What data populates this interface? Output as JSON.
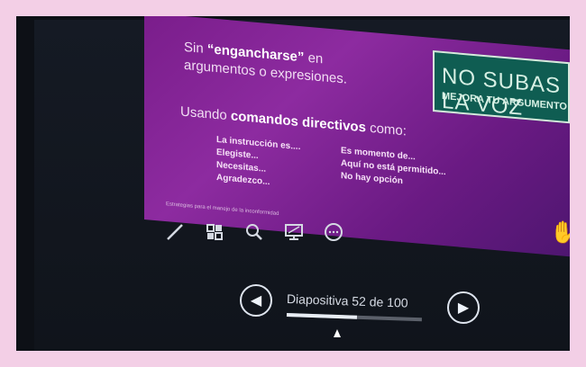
{
  "slide": {
    "line1_pre": "Sin ",
    "line1_bold": "“engancharse”",
    "line1_post": " en",
    "line2": "argumentos o expresiones.",
    "line3_pre": "Usando ",
    "line3_bold": "comandos directivos",
    "line3_post": " como:",
    "left_list": [
      "La instrucción es....",
      "Elegiste...",
      "Necesitas...",
      "Agradezco..."
    ],
    "right_list": [
      "Es momento de...",
      "Aquí no está permitido...",
      "No hay opción"
    ],
    "footer": "Estrategias para el manejo de la inconformidad",
    "logo_line1": "NO SUBAS LA VOZ",
    "logo_line2": "MEJORA TU ARGUMENTO"
  },
  "toolbar": {
    "tools": [
      {
        "name": "pen-icon"
      },
      {
        "name": "slides-grid-icon"
      },
      {
        "name": "zoom-icon"
      },
      {
        "name": "screen-icon"
      },
      {
        "name": "more-options-icon"
      }
    ]
  },
  "navigation": {
    "slide_label": "Diapositiva 52 de 100",
    "current": 52,
    "total": 100,
    "progress": 0.52
  },
  "colors": {
    "slide_purple": "#7a1d8b",
    "logo_green": "#0f5d52",
    "screen_dark": "#10141b"
  }
}
